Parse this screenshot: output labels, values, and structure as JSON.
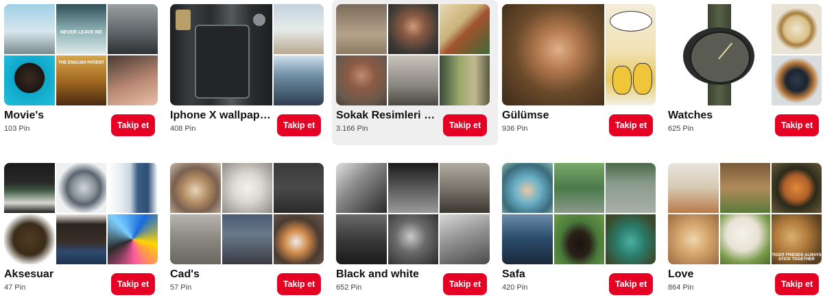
{
  "follow_label": "Takip et",
  "boards": [
    {
      "title": "Movie's",
      "count": "103 Pin",
      "posters": [
        "NEVER LEAVE ME",
        "THE ENGLISH PATIENT"
      ]
    },
    {
      "title": "Iphone X wallpapers",
      "count": "408 Pin"
    },
    {
      "title": "Sokak Resimleri ve...",
      "count": "3.166 Pin"
    },
    {
      "title": "Gülümse",
      "count": "936 Pin"
    },
    {
      "title": "Watches",
      "count": "625 Pin"
    },
    {
      "title": "Aksesuar",
      "count": "47 Pin"
    },
    {
      "title": "Cad's",
      "count": "57 Pin"
    },
    {
      "title": "Black and white",
      "count": "652 Pin"
    },
    {
      "title": "Safa",
      "count": "420 Pin"
    },
    {
      "title": "Love",
      "count": "864 Pin",
      "caption": "TIGER FRIENDS ALWAYS STICK TOGETHER"
    }
  ],
  "colors": {
    "follow_button": "#e60023",
    "hover_board": "#efefef"
  }
}
